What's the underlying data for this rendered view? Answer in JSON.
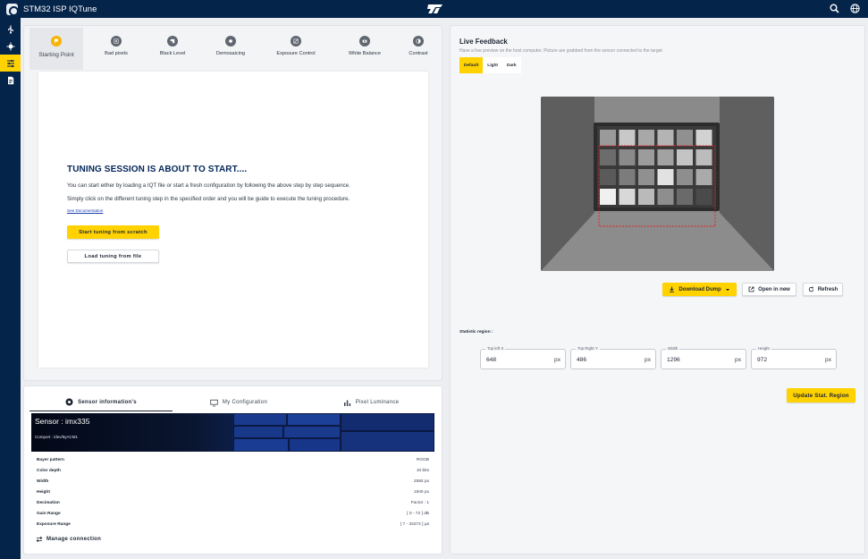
{
  "app": {
    "title": "STM32 ISP IQTune"
  },
  "colors": {
    "navy": "#05244a",
    "accent": "#ffd200",
    "step_active": "#f6b400"
  },
  "sidebar": {
    "items": [
      {
        "icon": "usb-icon"
      },
      {
        "icon": "chip-icon"
      },
      {
        "icon": "tune-sliders-icon",
        "active": true
      },
      {
        "icon": "document-icon"
      }
    ]
  },
  "stepper": {
    "steps": [
      {
        "label": "Starting Point",
        "icon": "flag-icon",
        "active": true
      },
      {
        "label": "Bad pixels",
        "icon": "bad-pixels-icon"
      },
      {
        "label": "Black Level",
        "icon": "black-level-icon"
      },
      {
        "label": "Demosaicing",
        "icon": "demosaicing-icon"
      },
      {
        "label": "Exposure Control",
        "icon": "exposure-icon"
      },
      {
        "label": "White Balance",
        "icon": "white-balance-icon"
      },
      {
        "label": "Contrast",
        "icon": "contrast-icon"
      }
    ]
  },
  "tuning": {
    "title": "TUNING SESSION IS ABOUT TO START....",
    "p1": "You can start either by loading a IQT file or start a fresh configuration by following the above step by step sequence.",
    "p2": "Simply click on the different tuning step in the specified order and you will be guide to execute the tuning procedure.",
    "doc_link": "See Documentation",
    "start_button": "Start tuning from scratch",
    "load_button": "Load tuning from file"
  },
  "info_tabs": [
    {
      "label": "Sensor information's",
      "active": true
    },
    {
      "label": "My Configuration"
    },
    {
      "label": "Pixel Luminance"
    }
  ],
  "sensor": {
    "name": "Sensor : imx335",
    "comport": "Comport : /dev/ttyACM1",
    "specs": [
      {
        "key": "Bayer pattern",
        "value": "RGGB"
      },
      {
        "key": "Color depth",
        "value": "10 bits"
      },
      {
        "key": "Width",
        "value": "2592 px"
      },
      {
        "key": "Height",
        "value": "1940 px"
      },
      {
        "key": "Decimation",
        "value": "Factor : 1"
      },
      {
        "key": "Gain Range",
        "value": "[ 0 - 72 ] dB"
      },
      {
        "key": "Exposure Range",
        "value": "[ 7 - 33274 ] µs"
      }
    ],
    "manage_connection": "Manage connection"
  },
  "feedback": {
    "title": "Live Feedback",
    "subtitle": "Have a live preview on the host computer. Picture are grabbed from the sensor connected to the target",
    "modes": [
      {
        "label": "Default",
        "active": true
      },
      {
        "label": "Light"
      },
      {
        "label": "Dark"
      }
    ],
    "download_label": "Download Dump",
    "open_label": "Open in new",
    "refresh_label": "Refresh",
    "stat_label": "Statistic region :",
    "fields": [
      {
        "label": "Top left X",
        "value": "648",
        "unit": "px"
      },
      {
        "label": "Top Right Y",
        "value": "486",
        "unit": "px"
      },
      {
        "label": "Width",
        "value": "1296",
        "unit": "px"
      },
      {
        "label": "Height",
        "value": "972",
        "unit": "px"
      }
    ],
    "update_label": "Update Stat. Region"
  }
}
